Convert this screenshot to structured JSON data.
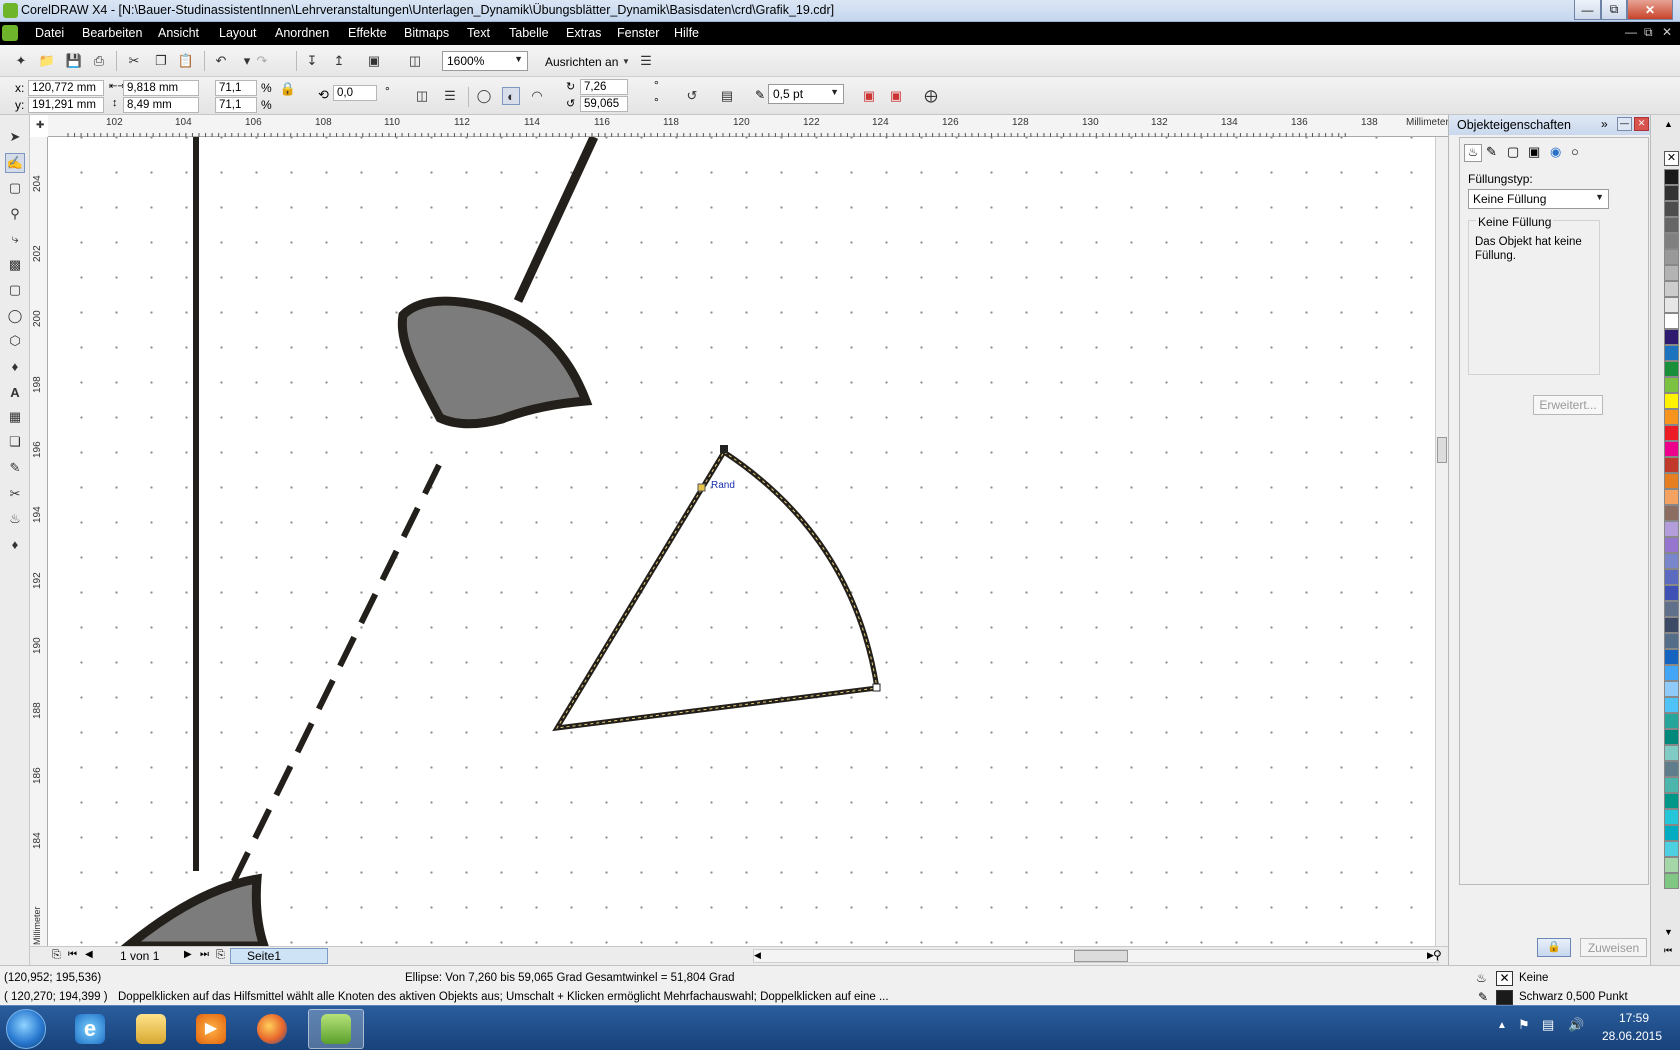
{
  "window": {
    "title": "CorelDRAW X4 - [N:\\Bauer-StudinassistentInnen\\Lehrveranstaltungen\\Unterlagen_Dynamik\\Übungsblätter_Dynamik\\Basisdaten\\crd\\Grafik_19.cdr]"
  },
  "menu": [
    "Datei",
    "Bearbeiten",
    "Ansicht",
    "Layout",
    "Anordnen",
    "Effekte",
    "Bitmaps",
    "Text",
    "Tabelle",
    "Extras",
    "Fenster",
    "Hilfe"
  ],
  "toolbar": {
    "zoom": "1600%",
    "snap_label": "Ausrichten an"
  },
  "propbar": {
    "x": "120,772 mm",
    "y": "191,291 mm",
    "x_label": "x:",
    "y_label": "y:",
    "width": "9,818 mm",
    "height": "8,49 mm",
    "scale_x": "71,1",
    "scale_y": "71,1",
    "percent": "%",
    "rotation": "0,0",
    "degree": "°",
    "start_angle": "7,26",
    "end_angle": "59,065",
    "outline_width": "0,5 pt"
  },
  "ruler": {
    "unit": "Millimeter",
    "h_ticks": [
      "102",
      "104",
      "106",
      "108",
      "110",
      "112",
      "114",
      "116",
      "118",
      "120",
      "122",
      "124",
      "126",
      "128",
      "130",
      "132",
      "134",
      "136",
      "138"
    ],
    "v_ticks": [
      "204",
      "202",
      "200",
      "198",
      "196",
      "194",
      "192",
      "190",
      "188",
      "186",
      "184"
    ]
  },
  "canvas": {
    "node_tooltip": "Rand"
  },
  "page_nav": {
    "count": "1 von 1",
    "tab": "Seite1"
  },
  "docker": {
    "title": "Objekteigenschaften",
    "fill_type_label": "Füllungstyp:",
    "fill_type_value": "Keine Füllung",
    "group_title": "Keine Füllung",
    "group_text": "Das Objekt hat keine Füllung.",
    "advanced_button": "Erweitert...",
    "assign_button": "Zuweisen"
  },
  "palette": {
    "colors": [
      "#1a1a1a",
      "#333333",
      "#4d4d4d",
      "#666666",
      "#808080",
      "#999999",
      "#b3b3b3",
      "#cccccc",
      "#e6e6e6",
      "#ffffff",
      "#2e1a6e",
      "#1e73be",
      "#1a8f3a",
      "#7cc242",
      "#fff200",
      "#f7941d",
      "#ed1c24",
      "#ec008c",
      "#c0392b",
      "#e67e22",
      "#f4a261",
      "#8c6d62",
      "#b39ddb",
      "#9575cd",
      "#7986cb",
      "#5c6bc0",
      "#3f51b5",
      "#606f8a",
      "#3d4a66",
      "#546e8a",
      "#1565c0",
      "#42a5f5",
      "#90caf9",
      "#4fc3f7",
      "#26a69a",
      "#00897b",
      "#80cbc4",
      "#607d8b",
      "#4db6ac",
      "#009688",
      "#26c6da",
      "#00acc1",
      "#4dd0e1",
      "#a5d6a7",
      "#81c784"
    ]
  },
  "status": {
    "cursor1": "(120,952; 195,536)",
    "object_info": "Ellipse: Von 7,260 bis 59,065 Grad  Gesamtwinkel = 51,804 Grad",
    "fill_label": "Keine",
    "cursor2": "( 120,270; 194,399 )",
    "hint": "Doppelklicken auf das Hilfsmittel wählt alle Knoten des aktiven Objekts aus; Umschalt + Klicken ermöglicht Mehrfachauswahl; Doppelklicken auf eine ...",
    "outline_label": "Schwarz  0,500 Punkt"
  },
  "taskbar": {
    "time": "17:59",
    "date": "28.06.2015"
  }
}
